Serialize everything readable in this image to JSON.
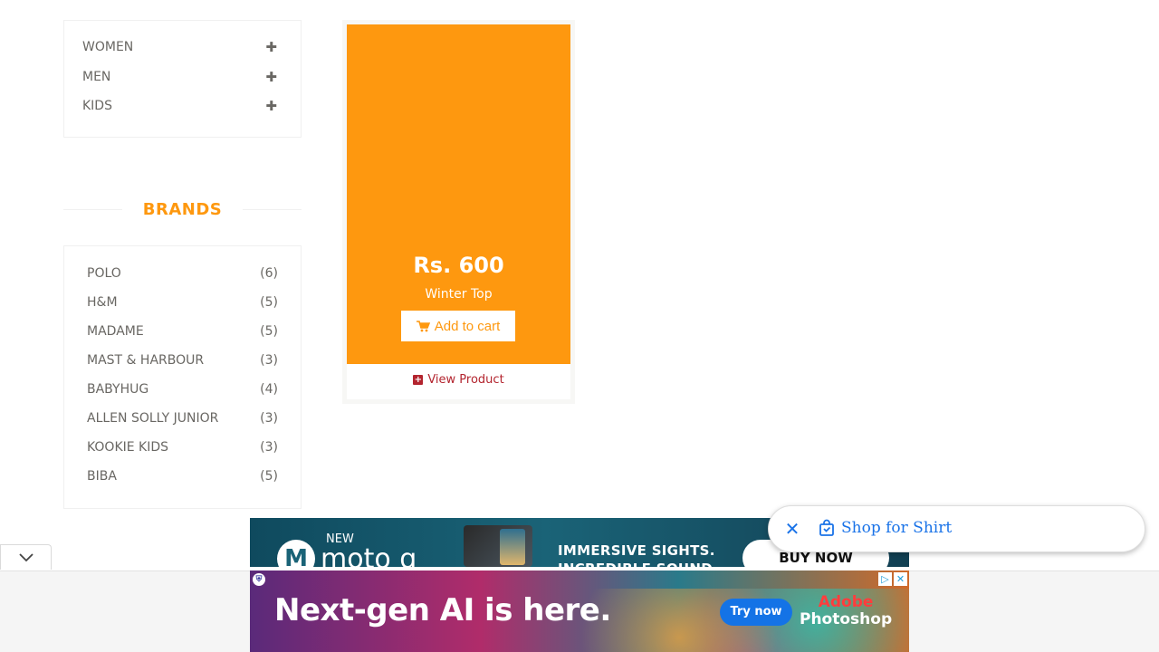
{
  "categories": [
    {
      "label": "WOMEN",
      "toggle": "✚"
    },
    {
      "label": "MEN",
      "toggle": "✚"
    },
    {
      "label": "KIDS",
      "toggle": "✚"
    }
  ],
  "brands": {
    "title": "BRANDS",
    "items": [
      {
        "name": "POLO",
        "count": "(6)"
      },
      {
        "name": "H&M",
        "count": "(5)"
      },
      {
        "name": "MADAME",
        "count": "(5)"
      },
      {
        "name": "MAST & HARBOUR",
        "count": "(3)"
      },
      {
        "name": "BABYHUG",
        "count": "(4)"
      },
      {
        "name": "ALLEN SOLLY JUNIOR",
        "count": "(3)"
      },
      {
        "name": "KOOKIE KIDS",
        "count": "(3)"
      },
      {
        "name": "BIBA",
        "count": "(5)"
      }
    ]
  },
  "product": {
    "price": "Rs. 600",
    "name": "Winter Top",
    "add_to_cart": "Add to cart",
    "view_product": "View Product"
  },
  "ad_top": {
    "new": "NEW",
    "brand": "moto g",
    "line1": "IMMERSIVE SIGHTS.",
    "line2": "INCREDIBLE SOUND.",
    "cta": "BUY NOW"
  },
  "ad_bottom": {
    "headline": "Next-gen AI is here.",
    "cta": "Try now",
    "brand1": "Adobe",
    "brand2": "Photoshop"
  },
  "shop_pill": {
    "label": "Shop for Shirt"
  },
  "colors": {
    "accent": "#FE980F",
    "link": "#B3242E",
    "text": "#696763",
    "pill_blue": "#1a73e8"
  }
}
